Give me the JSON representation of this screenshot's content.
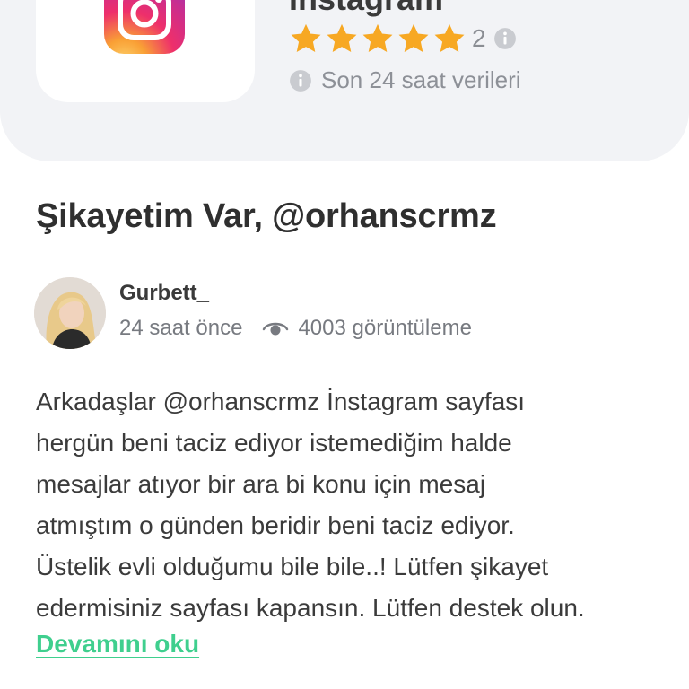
{
  "brand": {
    "name": "Instagram",
    "rating_count": "2",
    "data_note": "Son 24 saat verileri",
    "star_color": "#f7a823",
    "icons": {
      "logo": "instagram-logo",
      "star": "star-icon",
      "info": "info-icon"
    }
  },
  "complaint": {
    "title": "Şikayetim Var, @orhanscrmz",
    "author": {
      "username": "Gurbett_",
      "time": "24 saat önce",
      "views": "4003 görüntüleme"
    },
    "body": [
      "Arkadaşlar @orhanscrmz İnstagram sayfası",
      "hergün beni taciz ediyor istemediğim halde",
      "mesajlar atıyor bir ara bi konu için mesaj",
      "atmıştım o günden beridir beni taciz ediyor.",
      "Üstelik evli olduğumu bile bile..! Lütfen şikayet",
      "edermisiniz sayfası kapansın. Lütfen destek olun."
    ],
    "read_more": "Devamını oku",
    "link_color": "#3fcf8e"
  }
}
